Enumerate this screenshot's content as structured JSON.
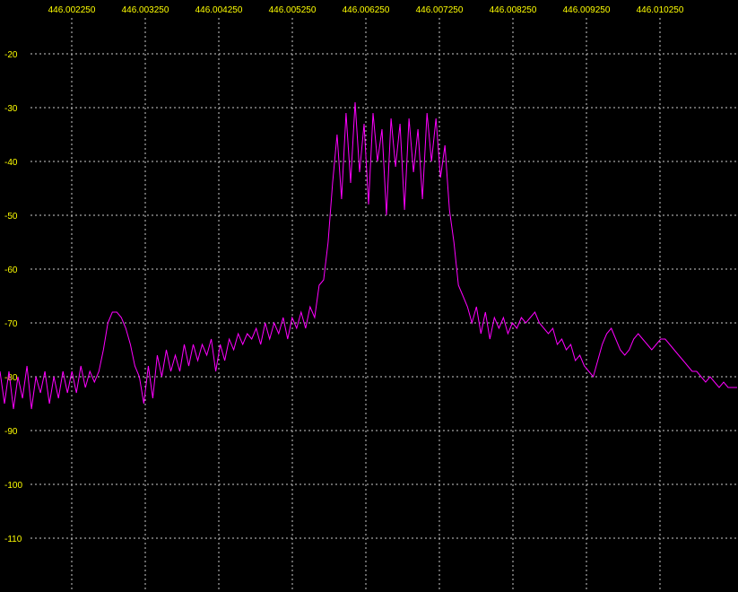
{
  "chart_data": {
    "type": "line",
    "title": "",
    "xlabel": "",
    "ylabel": "",
    "x_ticks": [
      "446.002250",
      "446.003250",
      "446.004250",
      "446.005250",
      "446.006250",
      "446.007250",
      "446.008250",
      "446.009250",
      "446.010250"
    ],
    "y_ticks": [
      "-20",
      "-30",
      "-40",
      "-50",
      "-60",
      "-70",
      "-80",
      "-90",
      "-100",
      "-110"
    ],
    "ylim": [
      -120,
      -10
    ],
    "grid": true,
    "colors": {
      "background": "#000000",
      "line": "#ff00ff",
      "grid": "#cccccc",
      "labels": "#ffff00"
    },
    "series": [
      {
        "x": [
          0,
          5,
          10,
          15,
          20,
          25,
          30,
          35,
          40,
          45,
          50,
          55,
          60,
          65,
          70,
          75,
          80,
          85,
          90,
          95,
          100,
          105,
          110,
          115,
          120,
          125,
          130,
          135,
          140,
          145,
          150,
          155,
          160,
          165,
          170,
          175,
          180,
          185,
          190,
          195,
          200,
          205,
          210,
          215,
          220,
          225,
          230,
          235,
          240,
          245,
          250,
          255,
          260,
          265,
          270,
          275,
          280,
          285,
          290,
          295,
          300,
          305,
          310,
          315,
          320,
          325,
          330,
          335,
          340,
          345,
          350,
          355,
          360,
          365,
          370,
          375,
          380,
          385,
          390,
          395,
          400,
          405,
          410,
          415,
          420,
          425,
          430,
          435,
          440,
          445,
          450,
          455,
          460,
          465,
          470,
          475,
          480,
          485,
          490,
          495,
          500,
          505,
          510,
          515,
          520,
          525,
          530,
          535,
          540,
          545,
          550,
          555,
          560,
          565,
          570,
          575,
          580,
          585,
          590,
          595,
          600,
          605,
          610,
          615,
          620,
          625,
          630,
          635,
          640,
          645,
          650,
          655,
          660,
          665,
          670,
          675,
          680,
          685,
          690,
          695,
          700,
          705,
          710,
          715,
          720,
          725,
          730,
          735,
          740,
          745,
          750,
          755,
          760,
          765,
          770,
          775,
          780,
          785,
          790,
          795,
          800,
          805,
          810,
          815,
          820
        ],
        "y": [
          -79,
          -85,
          -79,
          -86,
          -80,
          -84,
          -78,
          -86,
          -80,
          -83,
          -79,
          -85,
          -80,
          -84,
          -79,
          -83,
          -79,
          -83,
          -78,
          -82,
          -79,
          -81,
          -79,
          -75,
          -70,
          -68,
          -68,
          -69,
          -71,
          -74,
          -78,
          -80,
          -85,
          -78,
          -84,
          -76,
          -80,
          -75,
          -79,
          -76,
          -79,
          -74,
          -78,
          -74,
          -77,
          -74,
          -76,
          -73,
          -79,
          -74,
          -77,
          -73,
          -75,
          -72,
          -74,
          -72,
          -73,
          -71,
          -74,
          -70,
          -73,
          -70,
          -72,
          -69,
          -73,
          -69,
          -71,
          -68,
          -71,
          -67,
          -69,
          -63,
          -62,
          -55,
          -44,
          -35,
          -47,
          -31,
          -44,
          -29,
          -42,
          -33,
          -48,
          -31,
          -40,
          -34,
          -50,
          -32,
          -41,
          -33,
          -49,
          -32,
          -42,
          -34,
          -47,
          -31,
          -40,
          -32,
          -43,
          -37,
          -49,
          -55,
          -63,
          -65,
          -67,
          -70,
          -67,
          -72,
          -68,
          -73,
          -69,
          -71,
          -69,
          -72,
          -70,
          -71,
          -69,
          -70,
          -69,
          -68,
          -70,
          -71,
          -72,
          -71,
          -74,
          -73,
          -75,
          -74,
          -77,
          -76,
          -78,
          -79,
          -80,
          -77,
          -74,
          -72,
          -71,
          -73,
          -75,
          -76,
          -75,
          -73,
          -72,
          -73,
          -74,
          -75,
          -74,
          -73,
          -73,
          -74,
          -75,
          -76,
          -77,
          -78,
          -79,
          -79,
          -80,
          -81,
          -80,
          -81,
          -82,
          -81,
          -82,
          -82,
          -82
        ]
      }
    ]
  }
}
